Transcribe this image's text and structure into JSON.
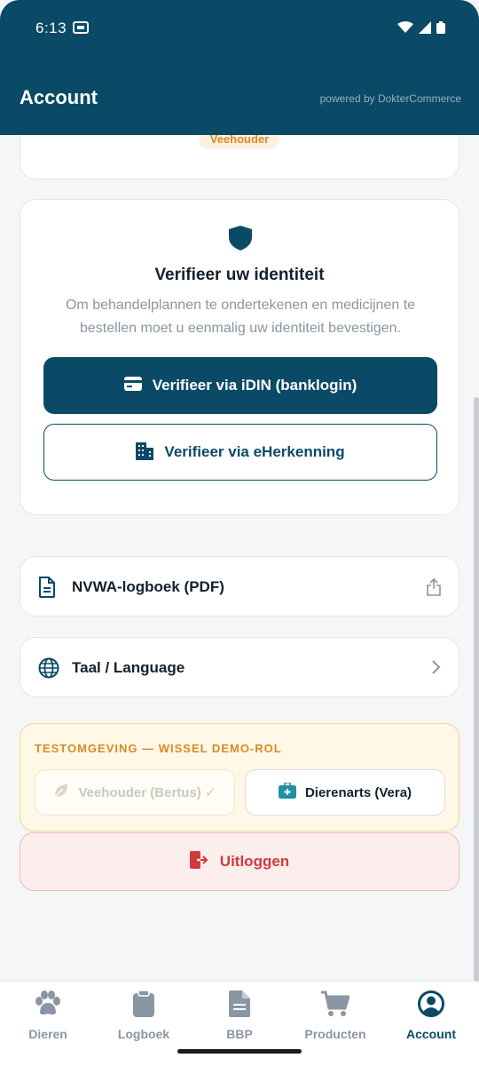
{
  "status": {
    "time": "6:13"
  },
  "header": {
    "title": "Account",
    "powered_by": "powered by DokterCommerce"
  },
  "profile": {
    "role_badge": "Veehouder"
  },
  "verify": {
    "title": "Verifieer uw identiteit",
    "description": "Om behandelplannen te ondertekenen en medicijnen te bestellen moet u eenmalig uw identiteit bevestigen.",
    "idin_label": "Verifieer via iDIN (banklogin)",
    "eherkenning_label": "Verifieer via eHerkenning"
  },
  "rows": {
    "logbook": "NVWA-logboek (PDF)",
    "language": "Taal / Language"
  },
  "test_env": {
    "title": "TESTOMGEVING — WISSEL DEMO-ROL",
    "farmer_role": "Veehouder (Bertus) ✓",
    "vet_role": "Dierenarts (Vera)"
  },
  "logout": {
    "label": "Uitloggen"
  },
  "tabs": [
    {
      "label": "Dieren",
      "icon": "paw-icon"
    },
    {
      "label": "Logboek",
      "icon": "clipboard-icon"
    },
    {
      "label": "BBP",
      "icon": "document-icon"
    },
    {
      "label": "Producten",
      "icon": "cart-icon"
    },
    {
      "label": "Account",
      "icon": "user-circle-icon"
    }
  ],
  "colors": {
    "primary": "#0b4a66",
    "accent_orange": "#d98a24",
    "danger": "#d33a3a",
    "muted": "#8a96a3"
  }
}
